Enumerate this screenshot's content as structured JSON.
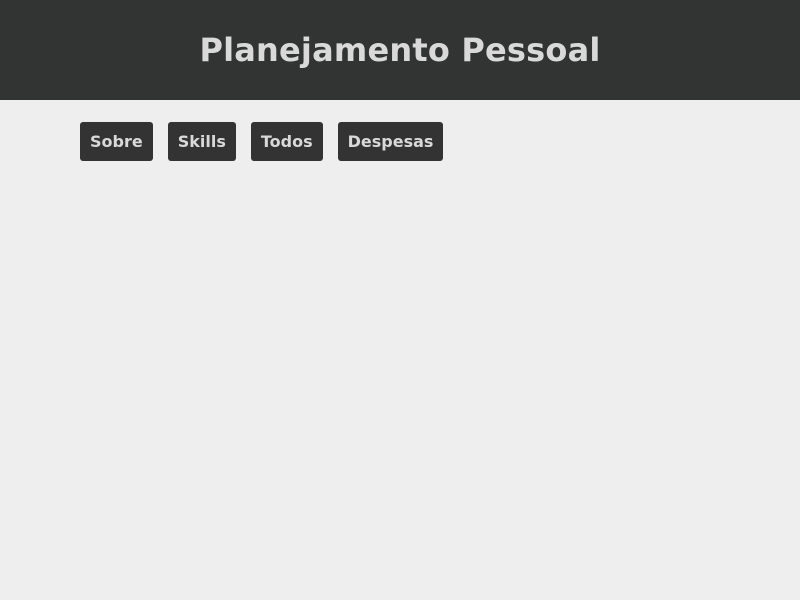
{
  "header": {
    "title": "Planejamento Pessoal"
  },
  "nav": {
    "items": [
      {
        "label": "Sobre"
      },
      {
        "label": "Skills"
      },
      {
        "label": "Todos"
      },
      {
        "label": "Despesas"
      }
    ]
  },
  "colors": {
    "header_background": "#323333",
    "page_background": "#eeeeee",
    "button_background": "#333333",
    "text_light": "#d9d9d9"
  }
}
